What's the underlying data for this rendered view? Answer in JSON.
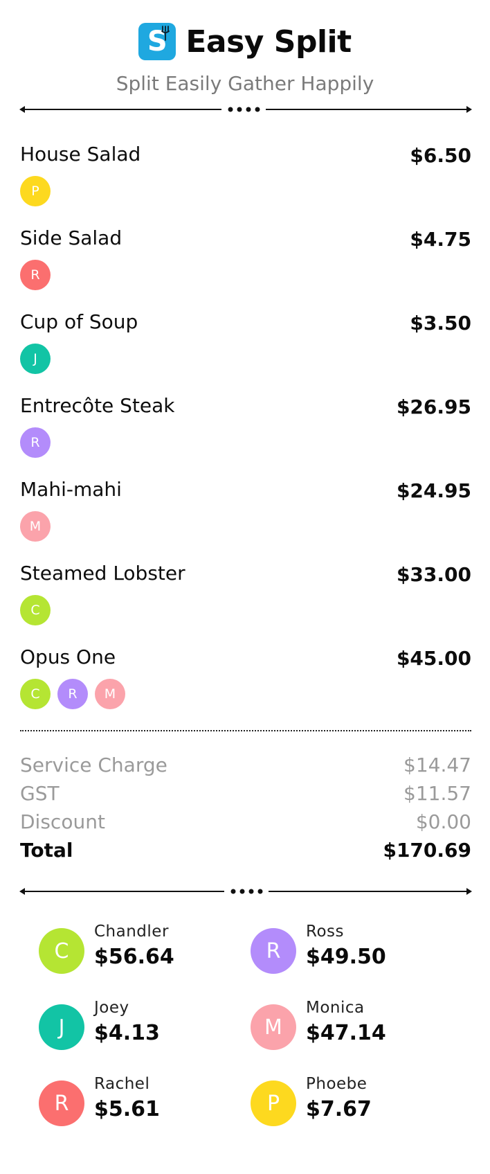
{
  "header": {
    "app_name": "Easy Split",
    "logo_letter": "S",
    "tagline": "Split Easily Gather Happily",
    "brand_color": "#1fa8e0"
  },
  "colors": {
    "C": "#b5e533",
    "R_ross": "#b38cfb",
    "J": "#12c4a5",
    "M": "#fba3ab",
    "R_rachel": "#fb6f6f",
    "P": "#fdd91f"
  },
  "items": [
    {
      "name": "House Salad",
      "price": "$6.50",
      "people": [
        {
          "initial": "P",
          "color": "#fdd91f"
        }
      ]
    },
    {
      "name": "Side Salad",
      "price": "$4.75",
      "people": [
        {
          "initial": "R",
          "color": "#fb6f6f"
        }
      ]
    },
    {
      "name": "Cup of Soup",
      "price": "$3.50",
      "people": [
        {
          "initial": "J",
          "color": "#12c4a5"
        }
      ]
    },
    {
      "name": "Entrecôte Steak",
      "price": "$26.95",
      "people": [
        {
          "initial": "R",
          "color": "#b38cfb"
        }
      ]
    },
    {
      "name": "Mahi-mahi",
      "price": "$24.95",
      "people": [
        {
          "initial": "M",
          "color": "#fba3ab"
        }
      ]
    },
    {
      "name": "Steamed Lobster",
      "price": "$33.00",
      "people": [
        {
          "initial": "C",
          "color": "#b5e533"
        }
      ]
    },
    {
      "name": "Opus One",
      "price": "$45.00",
      "people": [
        {
          "initial": "C",
          "color": "#b5e533"
        },
        {
          "initial": "R",
          "color": "#b38cfb"
        },
        {
          "initial": "M",
          "color": "#fba3ab"
        }
      ]
    }
  ],
  "summary": {
    "service_label": "Service Charge",
    "service_value": "$14.47",
    "gst_label": "GST",
    "gst_value": "$11.57",
    "discount_label": "Discount",
    "discount_value": "$0.00",
    "total_label": "Total",
    "total_value": "$170.69"
  },
  "people": [
    {
      "name": "Chandler",
      "initial": "C",
      "amount": "$56.64",
      "color": "#b5e533"
    },
    {
      "name": "Ross",
      "initial": "R",
      "amount": "$49.50",
      "color": "#b38cfb"
    },
    {
      "name": "Joey",
      "initial": "J",
      "amount": "$4.13",
      "color": "#12c4a5"
    },
    {
      "name": "Monica",
      "initial": "M",
      "amount": "$47.14",
      "color": "#fba3ab"
    },
    {
      "name": "Rachel",
      "initial": "R",
      "amount": "$5.61",
      "color": "#fb6f6f"
    },
    {
      "name": "Phoebe",
      "initial": "P",
      "amount": "$7.67",
      "color": "#fdd91f"
    }
  ]
}
